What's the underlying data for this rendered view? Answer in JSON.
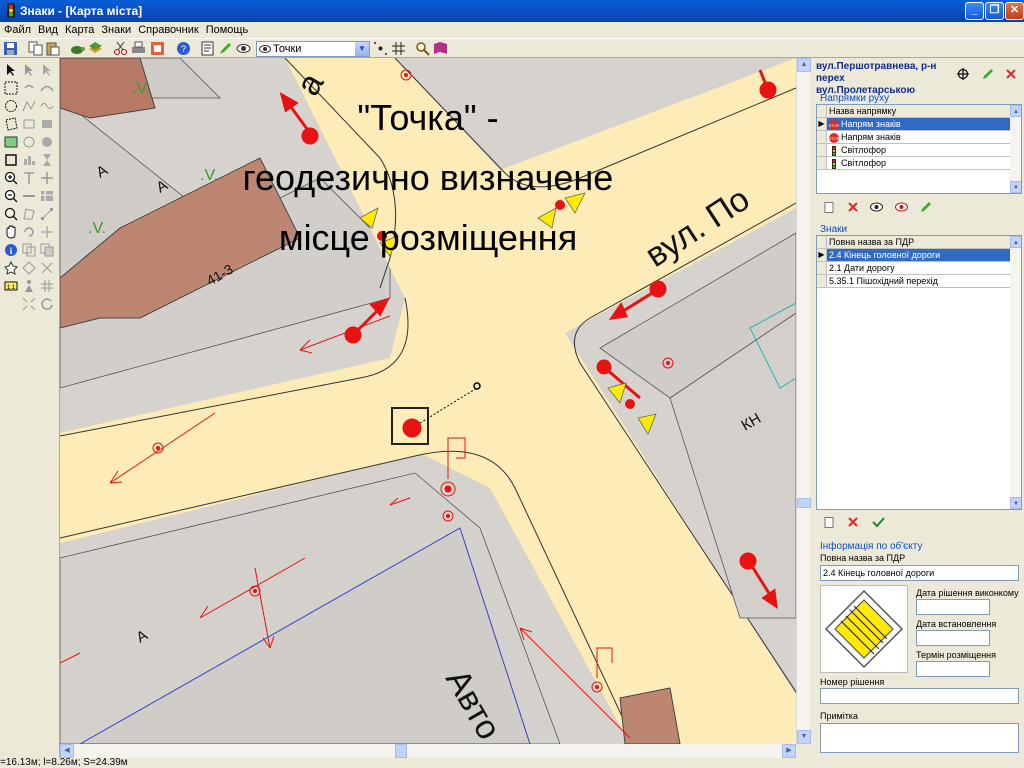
{
  "window": {
    "title": "Знаки - [Карта міста]",
    "buttons": [
      "_",
      "❐",
      "✕"
    ]
  },
  "menu": [
    "Файл",
    "Вид",
    "Карта",
    "Знаки",
    "Справочник",
    "Помощь"
  ],
  "toolbar": {
    "layer_select": "Точки"
  },
  "map": {
    "street_labels": [
      "вул. По",
      "Авто",
      "а"
    ],
    "building_labels": [
      "А",
      "А",
      "А",
      "41-3",
      "КН"
    ],
    "slide_overlay": [
      "\"Точка\" -",
      "геодезично визначене",
      "місце розміщення"
    ]
  },
  "right_panel": {
    "header": [
      "вул.Першотравнева, р-н перех",
      "вул.Пролетарською"
    ],
    "directions_group": "Напрямки руху",
    "directions_column": "Назва напрямку",
    "directions": [
      {
        "label": "Напрям знаків",
        "icon": "stop-sign-icon",
        "selected": true
      },
      {
        "label": "Напрям знаків",
        "icon": "stop-sign-icon",
        "selected": false
      },
      {
        "label": "Світлофор",
        "icon": "traffic-light-icon",
        "selected": false
      },
      {
        "label": "Світлофор",
        "icon": "traffic-light-icon",
        "selected": false
      }
    ],
    "signs_group": "Знаки",
    "signs_column": "Повна назва за ПДР",
    "signs": [
      {
        "label": "2.4 Кінець головної дороги",
        "selected": true
      },
      {
        "label": "2.1 Дати дорогу",
        "selected": false
      },
      {
        "label": "5.35.1 Пішохідний перехід",
        "selected": false
      }
    ],
    "info_group": "Інформація по об'єкту",
    "info": {
      "full_name_label": "Повна назва за ПДР",
      "full_name_value": "2.4 Кінець головної дороги",
      "decision_date_label": "Дата рішення виконкому",
      "install_date_label": "Дата встановлення",
      "placement_term_label": "Термін розміщення",
      "decision_number_label": "Номер рішення",
      "note_label": "Примітка"
    }
  },
  "status": {
    "text": "=16.13м; l=8.26м; S=24.39м"
  },
  "colors": {
    "road": "#fdebb8",
    "building": "#bd8672",
    "sign_marker": "#e81212",
    "selection": "#316ac5"
  }
}
